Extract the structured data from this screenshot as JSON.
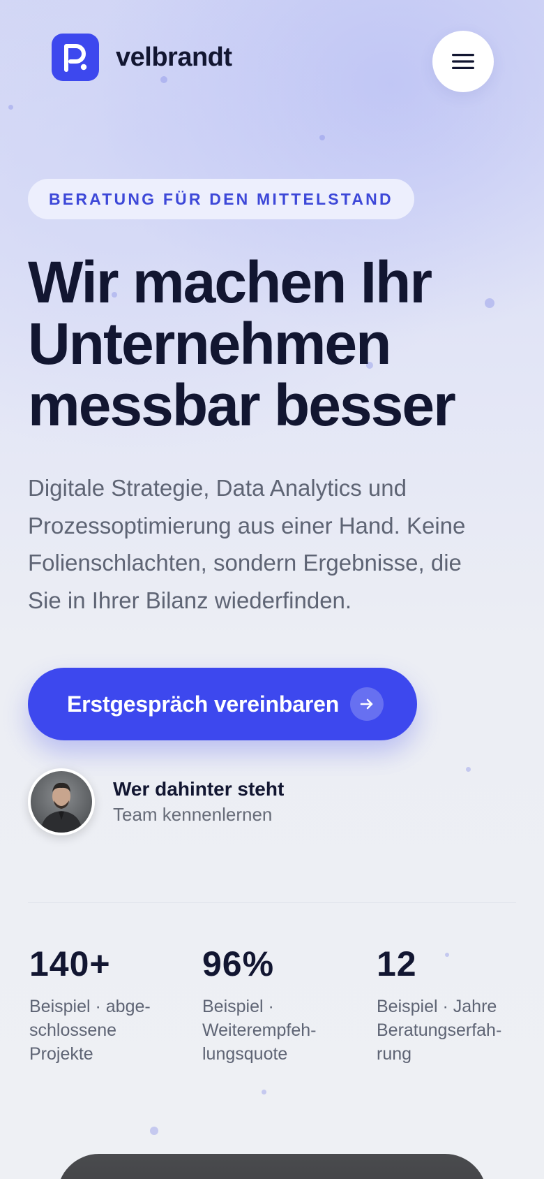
{
  "brand": {
    "name": "velbrandt",
    "logo_letter": "P",
    "accent": "#3d48ee"
  },
  "header": {
    "menu_icon": "hamburger-icon"
  },
  "hero": {
    "eyebrow": "BERATUNG FÜR DEN MITTELSTAND",
    "headline_lines": [
      "Wir machen Ihr",
      "Unternehmen",
      "messbar besser"
    ],
    "lead_lines": [
      "Digitale Strategie, Data Analytics und",
      "Prozessoptimierung aus einer Hand. Keine",
      "Folienschlachten, sondern Ergebnisse, die",
      "Sie in Ihrer Bilanz wiederfinden."
    ],
    "cta_label": "Erstgespräch vereinbaren",
    "cta_icon": "arrow-right-icon"
  },
  "team": {
    "title": "Wer dahinter steht",
    "subtitle": "Team kennenlernen"
  },
  "stats": [
    {
      "value": "140+",
      "label_lines": [
        "Beispiel · abge-",
        "schlossene",
        "Projekte"
      ]
    },
    {
      "value": "96%",
      "label_lines": [
        "Beispiel ·",
        "Weiterempfeh-",
        "lungsquote"
      ]
    },
    {
      "value": "12",
      "label_lines": [
        "Beispiel · Jahre",
        "Beratungserfah-",
        "rung"
      ]
    }
  ],
  "colors": {
    "text_dark": "#121631",
    "text_muted": "#5e6474",
    "eyebrow_text": "#3d48d8",
    "card_dark": "#3a3b3e"
  }
}
